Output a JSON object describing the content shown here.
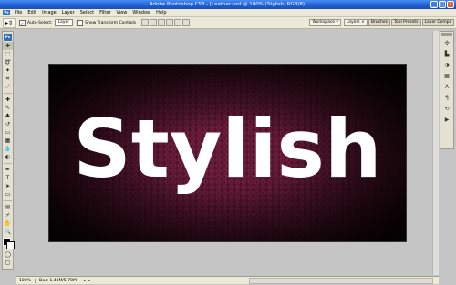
{
  "window": {
    "title": "Adobe Photoshop CS3 - [Leather.psd @ 100% (Stylish, RGB/8)]",
    "minimize": "_",
    "maximize": "□",
    "close": "x"
  },
  "menubar": {
    "logo": "Ps",
    "items": [
      "File",
      "Edit",
      "Image",
      "Layer",
      "Select",
      "Filter",
      "View",
      "Window",
      "Help"
    ]
  },
  "options": {
    "tool_preset_icon": "move-tool-icon",
    "tool_preset": "▸⇕",
    "auto_select_label": "Auto-Select:",
    "auto_select_checked": "✓",
    "auto_select_value": "Layer",
    "show_transform_label": "Show Transform Controls",
    "workspace_label": "Workspace ▾",
    "panel_tabs": [
      "Layers ×",
      "Brushes",
      "Tool Presets",
      "Layer Comps"
    ]
  },
  "toolbox": {
    "badge": "Ps",
    "tools": [
      {
        "name": "move-tool",
        "glyph": "✥"
      },
      {
        "name": "marquee-tool",
        "glyph": "⬚"
      },
      {
        "name": "lasso-tool",
        "glyph": "➰"
      },
      {
        "name": "magic-wand-tool",
        "glyph": "✦"
      },
      {
        "name": "crop-tool",
        "glyph": "⌗"
      },
      {
        "name": "slice-tool",
        "glyph": "⟋"
      },
      {
        "name": "healing-brush-tool",
        "glyph": "✚"
      },
      {
        "name": "brush-tool",
        "glyph": "✎"
      },
      {
        "name": "clone-stamp-tool",
        "glyph": "♣"
      },
      {
        "name": "history-brush-tool",
        "glyph": "↺"
      },
      {
        "name": "eraser-tool",
        "glyph": "▭"
      },
      {
        "name": "gradient-tool",
        "glyph": "▦"
      },
      {
        "name": "blur-tool",
        "glyph": "💧"
      },
      {
        "name": "dodge-tool",
        "glyph": "◐"
      },
      {
        "name": "pen-tool",
        "glyph": "✒"
      },
      {
        "name": "type-tool",
        "glyph": "T"
      },
      {
        "name": "path-selection-tool",
        "glyph": "➤"
      },
      {
        "name": "shape-tool",
        "glyph": "▭"
      },
      {
        "name": "notes-tool",
        "glyph": "✉"
      },
      {
        "name": "eyedropper-tool",
        "glyph": "⌿"
      },
      {
        "name": "hand-tool",
        "glyph": "✋"
      },
      {
        "name": "zoom-tool",
        "glyph": "🔍"
      }
    ],
    "mode_glyphs": [
      "◯",
      "▢"
    ]
  },
  "canvas": {
    "headline": "Stylish",
    "base_color": "#6b1d3a"
  },
  "dock": {
    "icons": [
      {
        "name": "navigator-icon",
        "glyph": "✣"
      },
      {
        "name": "histogram-icon",
        "glyph": "▙"
      },
      {
        "name": "color-icon",
        "glyph": "◑"
      },
      {
        "name": "swatches-icon",
        "glyph": "▦"
      },
      {
        "name": "character-icon",
        "glyph": "A"
      },
      {
        "name": "paragraph-icon",
        "glyph": "¶"
      },
      {
        "name": "history-icon",
        "glyph": "⟲"
      },
      {
        "name": "actions-icon",
        "glyph": "▶"
      }
    ]
  },
  "status": {
    "zoom": "100%",
    "doc": "Doc: 1.43M/5.70M",
    "nav_left": "◂",
    "nav_right": "▸"
  }
}
